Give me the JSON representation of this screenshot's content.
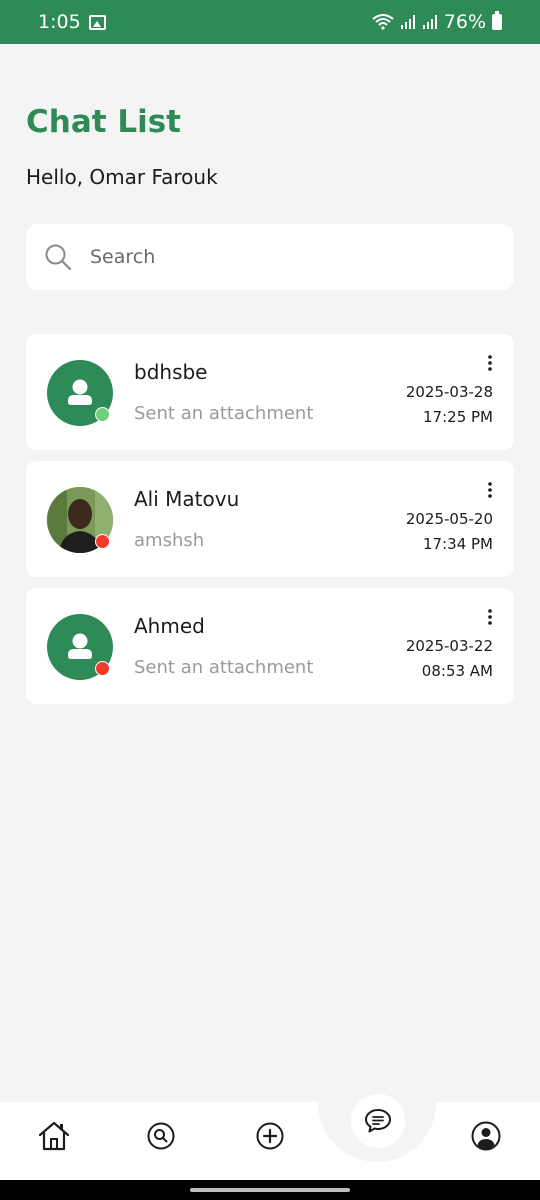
{
  "status_bar": {
    "time": "1:05",
    "battery": "76%"
  },
  "header": {
    "title": "Chat List",
    "greeting": "Hello, Omar Farouk"
  },
  "search": {
    "placeholder": "Search",
    "value": ""
  },
  "chats": [
    {
      "name": "bdhsbe",
      "preview": "Sent an attachment",
      "date": "2025-03-28",
      "time": "17:25 PM",
      "online": true,
      "avatar": "default-user-icon"
    },
    {
      "name": "Ali Matovu",
      "preview": "amshsh",
      "date": "2025-05-20",
      "time": "17:34 PM",
      "online": false,
      "avatar": "profile-photo"
    },
    {
      "name": "Ahmed",
      "preview": "Sent an attachment",
      "date": "2025-03-22",
      "time": "08:53 AM",
      "online": false,
      "avatar": "default-user-icon"
    }
  ],
  "colors": {
    "brand": "#2e8b57",
    "online": "#6fcf7a",
    "offline": "#f23a2a"
  },
  "nav": {
    "items": [
      "home-icon",
      "search-icon",
      "add-icon",
      "chat-icon",
      "profile-icon"
    ],
    "active": "chat-icon"
  }
}
